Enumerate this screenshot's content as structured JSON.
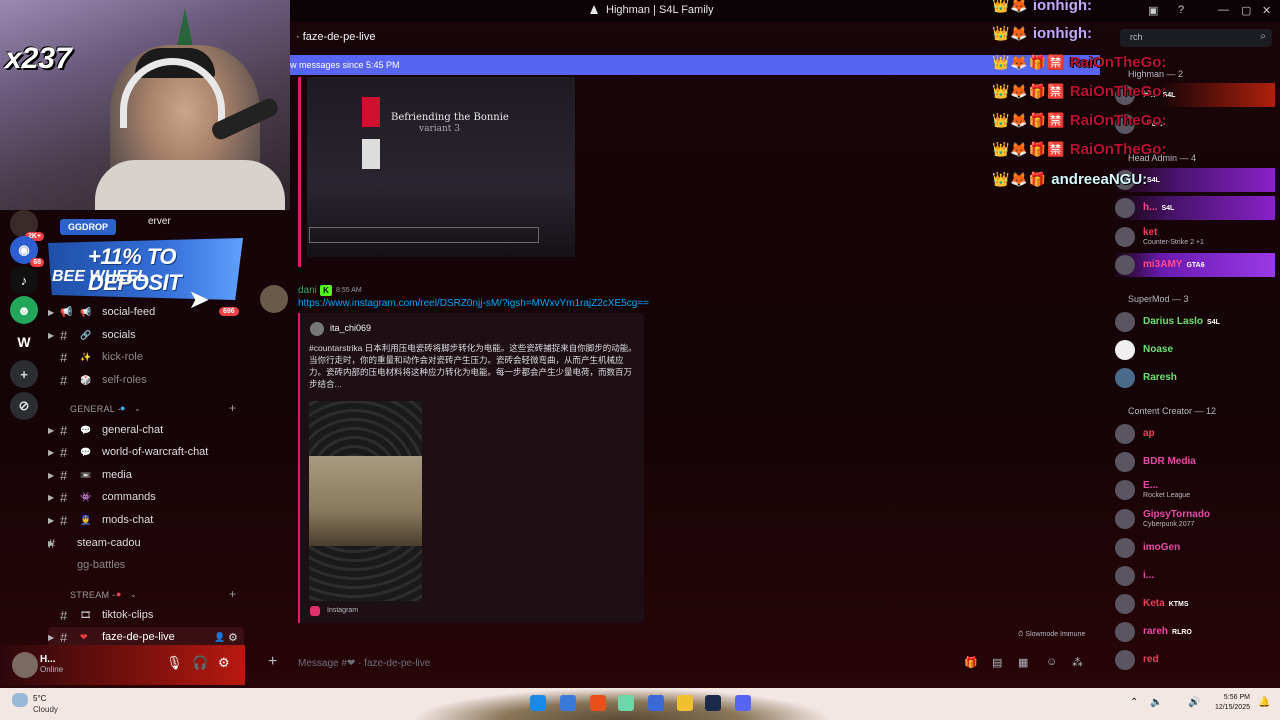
{
  "window": {
    "title": "Highman | S4L Family"
  },
  "webcam": {
    "count_overlay": "x237"
  },
  "promo": {
    "tag": "GGDROP",
    "headline": "+11% TO DEPOSIT",
    "sub": "BEE WHEEL",
    "badge": "696"
  },
  "rail": {
    "badges": [
      "2K+",
      "68"
    ],
    "icons": [
      "discord-home-icon",
      "server-icon",
      "tiktok-icon",
      "kick-icon",
      "w-server-icon",
      "add-server-icon",
      "discover-icon"
    ]
  },
  "channels": {
    "partial_header": "erver",
    "top_list": [
      {
        "name": "social-feed",
        "emoji": "📢"
      },
      {
        "name": "socials",
        "emoji": "🔗"
      },
      {
        "name": "kick-role",
        "emoji": "✨"
      },
      {
        "name": "self-roles",
        "emoji": "🎲"
      }
    ],
    "categories": [
      {
        "label": "GENERAL -",
        "items": [
          {
            "name": "general-chat",
            "emoji": "💬"
          },
          {
            "name": "world-of-warcraft-chat",
            "emoji": "💬"
          },
          {
            "name": "media",
            "emoji": "📼"
          },
          {
            "name": "commands",
            "emoji": "👾"
          },
          {
            "name": "mods-chat",
            "emoji": "👮"
          },
          {
            "name": "steam-cadou",
            "emoji": ""
          },
          {
            "name": "gg-battles",
            "emoji": ""
          }
        ]
      },
      {
        "label": "STREAM -",
        "items": [
          {
            "name": "tiktok-clips",
            "emoji": "🎞"
          },
          {
            "name": "faze-de-pe-live",
            "emoji": "❤"
          }
        ]
      }
    ]
  },
  "user": {
    "name": "H...",
    "status": "Online"
  },
  "chat": {
    "channel": "faze-de-pe-live",
    "new_messages": "w messages since 5:45 PM",
    "video_title": "Befriending the Bonnie",
    "video_sub": "variant 3",
    "message": {
      "author": "dani",
      "badge": "K",
      "time": "8:55 AM",
      "link": "https://www.instagram.com/reel/DSRZ0njj-sM/?igsh=MWxvYm1rajZ2cXE5cg=="
    },
    "embed": {
      "author": "ita_chi069",
      "description": "#countarstrika 日本利用压电瓷砖将脚步转化为电能。这些瓷砖捕捉来自你脚步的动能。当你行走时，你的重量和动作会对瓷砖产生压力。瓷砖会轻微弯曲，从而产生机械应力。瓷砖内部的压电材料将这种应力转化为电能。每一步都会产生少量电荷，而数百万步结合...",
      "footer": "Instagram"
    },
    "slowmode": "Slowmode Immune",
    "input_placeholder": "Message #❤ · faze-de-pe-live"
  },
  "stream_chat": [
    {
      "name": "ionhigh:",
      "style": "purple"
    },
    {
      "name": "ionhigh:",
      "style": "purple"
    },
    {
      "name": "RaiOnTheGo:",
      "style": "red"
    },
    {
      "name": "RaiOnTheGo:",
      "style": "red"
    },
    {
      "name": "RaiOnTheGo:",
      "style": "red"
    },
    {
      "name": "RaiOnTheGo:",
      "style": "red"
    },
    {
      "name": "andreeaNGU:",
      "style": "green"
    }
  ],
  "members": {
    "search_placeholder": "rch",
    "groups": [
      {
        "role": "Highman — 2",
        "members": [
          {
            "name": "H...",
            "tag": "S4L",
            "color": "#c0c0c0"
          },
          {
            "name": "",
            "tag": "Post",
            "color": "#c0c0c0"
          }
        ]
      },
      {
        "role": "Head Admin — 4",
        "members": [
          {
            "name": "",
            "tag": "S4L",
            "color": "#e8e8e8"
          },
          {
            "name": "h...",
            "tag": "S4L",
            "color": "#ff4a8a"
          },
          {
            "name": "ket",
            "activity": "Counter-Strike 2 +1",
            "color": "#e8435a"
          },
          {
            "name": "mi3AMY",
            "tag": "GTA6",
            "color": "#ff4a8a"
          }
        ]
      },
      {
        "role": "SuperMod — 3",
        "members": [
          {
            "name": "Darius Laslo",
            "tag": "S4L",
            "color": "#6fe06f"
          },
          {
            "name": "Noase",
            "color": "#6fe06f"
          },
          {
            "name": "Raresh",
            "color": "#6fe06f"
          }
        ]
      },
      {
        "role": "Content Creator — 12",
        "members": [
          {
            "name": "ap",
            "color": "#e8435a"
          },
          {
            "name": "BDR Media",
            "color": "#e84aa8"
          },
          {
            "name": "E...",
            "activity": "Rocket League",
            "color": "#e84aa8"
          },
          {
            "name": "GipsyTornado",
            "activity": "Cyberpunk 2077",
            "color": "#e84aa8"
          },
          {
            "name": "imoGen",
            "color": "#e84aa8"
          },
          {
            "name": "i...",
            "color": "#e84aa8"
          },
          {
            "name": "Keta",
            "tag": "KTMS",
            "color": "#e8435a"
          },
          {
            "name": "rareh",
            "tag": "RLRO",
            "color": "#e84aa8"
          },
          {
            "name": "red",
            "color": "#e8435a"
          }
        ]
      }
    ]
  },
  "taskbar": {
    "temp": "5°C",
    "condition": "Cloudy",
    "time": "5:56 PM",
    "date": "12/15/2025"
  },
  "colors": {
    "accent": "#5865f2",
    "brand_red": "#e31a6c",
    "kick_green": "#53fc18"
  }
}
